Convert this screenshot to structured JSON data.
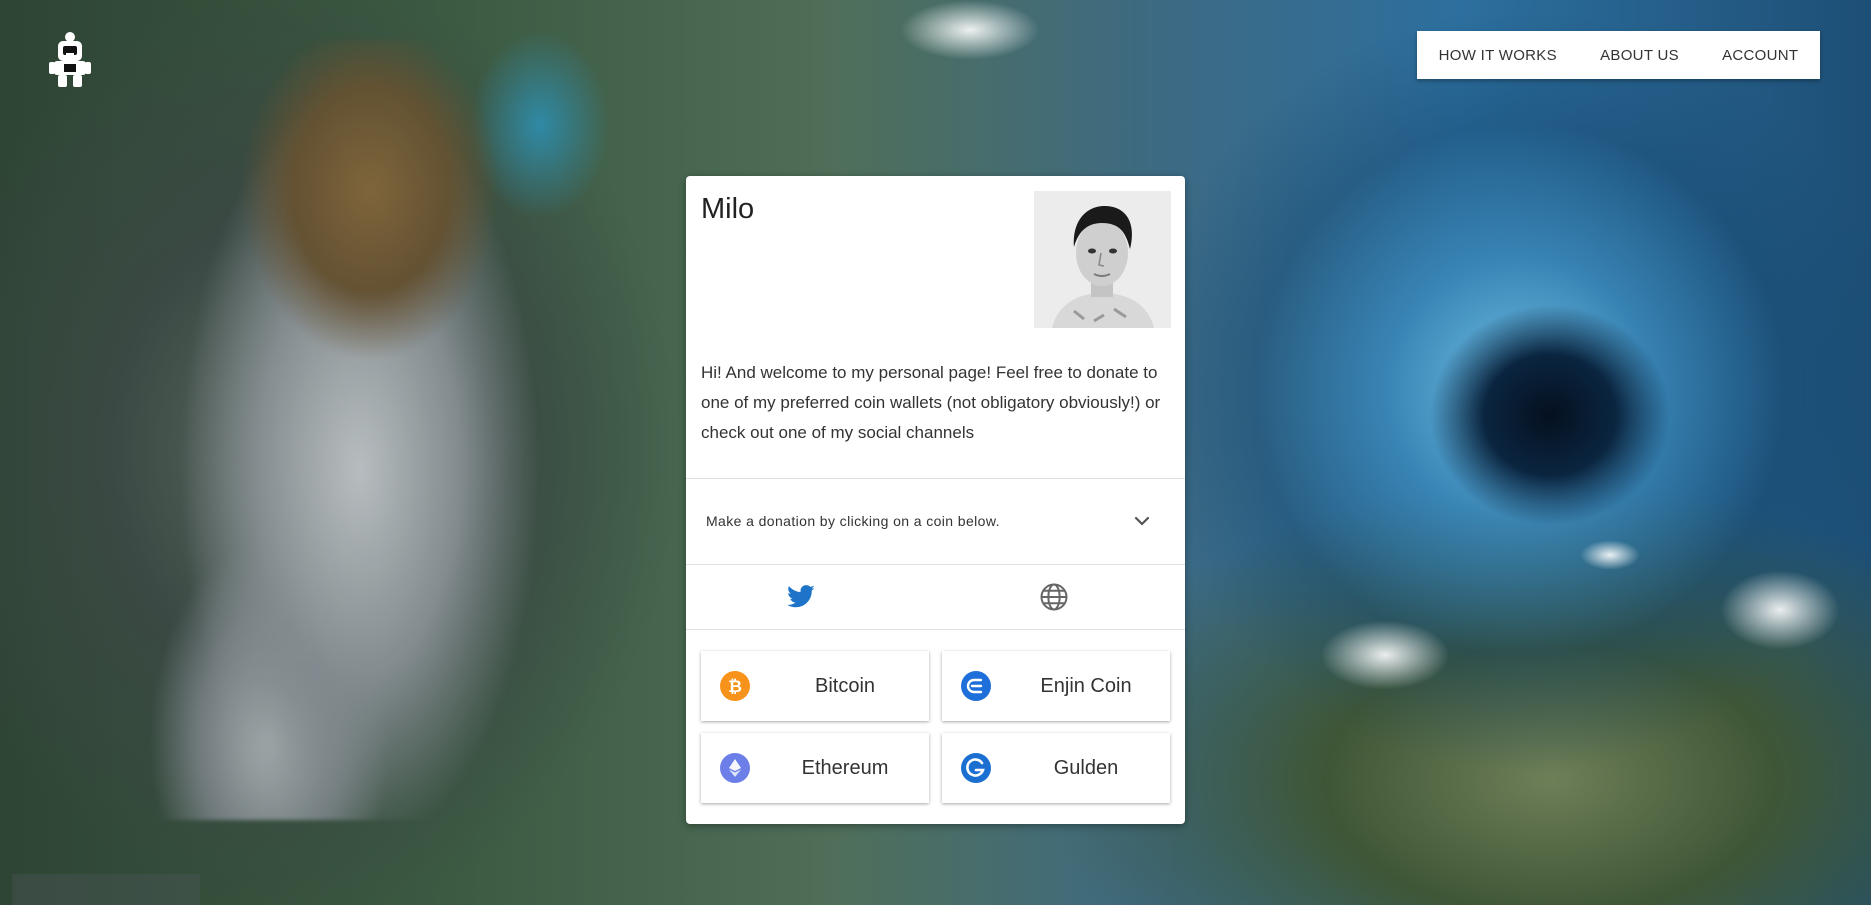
{
  "nav": {
    "items": [
      "HOW IT WORKS",
      "ABOUT US",
      "ACCOUNT"
    ]
  },
  "profile": {
    "name": "Milo",
    "bio": "Hi! And welcome to my personal page! Feel free to donate to one of my preferred coin wallets (not obligatory obviously!) or check out one of my social channels"
  },
  "donation": {
    "prompt": "Make a donation by clicking on a coin below."
  },
  "social": {
    "icons": [
      "twitter-icon",
      "globe-icon"
    ],
    "twitter_color": "#1d74c9"
  },
  "coins": [
    {
      "label": "Bitcoin",
      "icon": "bitcoin-icon",
      "color": "#f7931a"
    },
    {
      "label": "Enjin Coin",
      "icon": "enjin-coin-icon",
      "color": "#1e6fd9"
    },
    {
      "label": "Ethereum",
      "icon": "ethereum-icon",
      "color": "#6c7fe8"
    },
    {
      "label": "Gulden",
      "icon": "gulden-icon",
      "color": "#1b6fd0"
    }
  ]
}
